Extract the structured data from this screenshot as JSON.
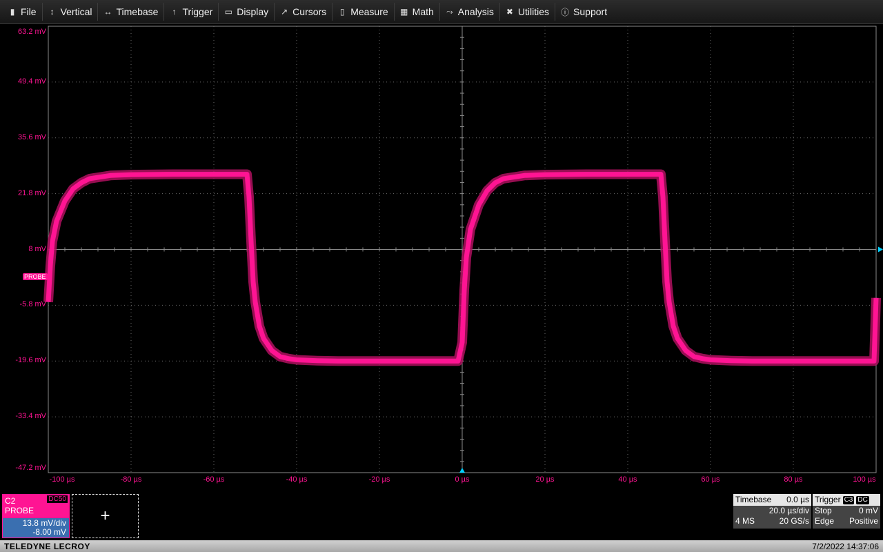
{
  "menu": [
    {
      "label": "File",
      "icon": "file-icon",
      "glyph": "▮"
    },
    {
      "label": "Vertical",
      "icon": "vertical-arrows-icon",
      "glyph": "↕"
    },
    {
      "label": "Timebase",
      "icon": "horizontal-arrows-icon",
      "glyph": "↔"
    },
    {
      "label": "Trigger",
      "icon": "trigger-icon",
      "glyph": "↑"
    },
    {
      "label": "Display",
      "icon": "display-icon",
      "glyph": "▭"
    },
    {
      "label": "Cursors",
      "icon": "cursor-icon",
      "glyph": "↗"
    },
    {
      "label": "Measure",
      "icon": "measure-icon",
      "glyph": "▯"
    },
    {
      "label": "Math",
      "icon": "calculator-icon",
      "glyph": "▦"
    },
    {
      "label": "Analysis",
      "icon": "chart-icon",
      "glyph": "⤳"
    },
    {
      "label": "Utilities",
      "icon": "tools-icon",
      "glyph": "✖"
    },
    {
      "label": "Support",
      "icon": "info-icon",
      "glyph": "ⓘ"
    }
  ],
  "chart_data": {
    "type": "line",
    "series": [
      {
        "name": "C2",
        "color": "#ff1493",
        "x": [
          -100,
          -99.5,
          -99,
          -98,
          -96,
          -94,
          -92,
          -90,
          -85,
          -80,
          -70,
          -60,
          -52,
          -51.5,
          -51,
          -50.5,
          -50,
          -49,
          -48,
          -46,
          -44,
          -42,
          -40,
          -35,
          -30,
          -20,
          -10,
          -1,
          0,
          0.5,
          1,
          2,
          4,
          6,
          8,
          10,
          15,
          20,
          30,
          40,
          48,
          48.5,
          49,
          49.5,
          50,
          51,
          52,
          54,
          56,
          58,
          60,
          65,
          70,
          80,
          90,
          99.5,
          100
        ],
        "y": [
          -5,
          4,
          10,
          15,
          20,
          23,
          24.5,
          25.5,
          26.3,
          26.5,
          26.6,
          26.6,
          26.6,
          21,
          10,
          0,
          -5,
          -11,
          -14,
          -17,
          -18.5,
          -19,
          -19.3,
          -19.5,
          -19.6,
          -19.6,
          -19.6,
          -19.6,
          -15,
          -2,
          6,
          13,
          19,
          22.5,
          24.5,
          25.5,
          26.3,
          26.5,
          26.6,
          26.6,
          26.6,
          21,
          10,
          0,
          -5,
          -11,
          -14,
          -17,
          -18.5,
          -19,
          -19.3,
          -19.5,
          -19.6,
          -19.6,
          -19.6,
          -19.6,
          -4
        ]
      }
    ],
    "xlabel": "",
    "ylabel": "",
    "x_ticks": [
      "-100 µs",
      "-80 µs",
      "-60 µs",
      "-40 µs",
      "-20 µs",
      "0 µs",
      "20 µs",
      "40 µs",
      "60 µs",
      "80 µs",
      "100 µs"
    ],
    "y_ticks": [
      "63.2 mV",
      "49.4 mV",
      "35.6 mV",
      "21.8 mV",
      "8 mV",
      "-5.8 mV",
      "-19.6 mV",
      "-33.4 mV",
      "-47.2 mV"
    ],
    "xlim": [
      -100,
      100
    ],
    "ylim": [
      -47.2,
      63.2
    ],
    "grid": true,
    "grid_color": "#6b6b6b",
    "bg_color": "#000000"
  },
  "probe_tag": "PROBE",
  "channel": {
    "name": "C2",
    "label": "PROBE",
    "coupling": "DC50",
    "scale": "13.8 mV/div",
    "offset": "-8.00 mV"
  },
  "add_button": "+",
  "timebase": {
    "title": "Timebase",
    "delay": "0.0 µs",
    "scale": "20.0 µs/div",
    "memory": "4 MS",
    "rate": "20 GS/s"
  },
  "trigger": {
    "title": "Trigger",
    "source_tag": "C3",
    "coupling_tag": "DC",
    "mode": "Stop",
    "level": "0 mV",
    "type": "Edge",
    "slope": "Positive"
  },
  "footer": {
    "brand": "TELEDYNE LECROY",
    "datetime": "7/2/2022 14:37:06"
  }
}
